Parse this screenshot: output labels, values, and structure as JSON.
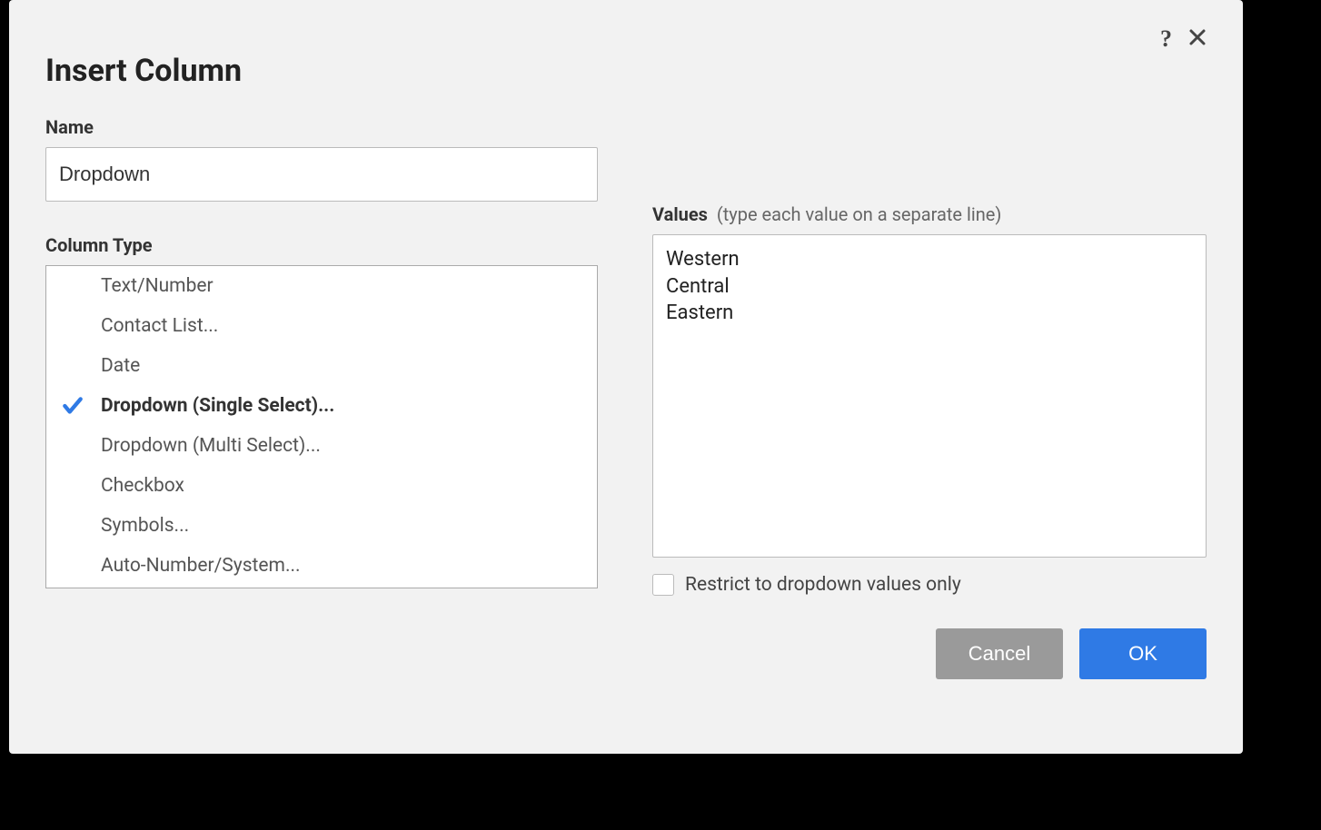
{
  "dialog": {
    "title": "Insert Column"
  },
  "name": {
    "label": "Name",
    "value": "Dropdown"
  },
  "columnType": {
    "label": "Column Type",
    "items": [
      "Text/Number",
      "Contact List...",
      "Date",
      "Dropdown (Single Select)...",
      "Dropdown (Multi Select)...",
      "Checkbox",
      "Symbols...",
      "Auto-Number/System..."
    ],
    "selectedIndex": 3
  },
  "values": {
    "label": "Values",
    "hint": "(type each value on a separate line)",
    "text": "Western\nCentral\nEastern"
  },
  "restrict": {
    "label": "Restrict to dropdown values only",
    "checked": false
  },
  "buttons": {
    "cancel": "Cancel",
    "ok": "OK"
  }
}
